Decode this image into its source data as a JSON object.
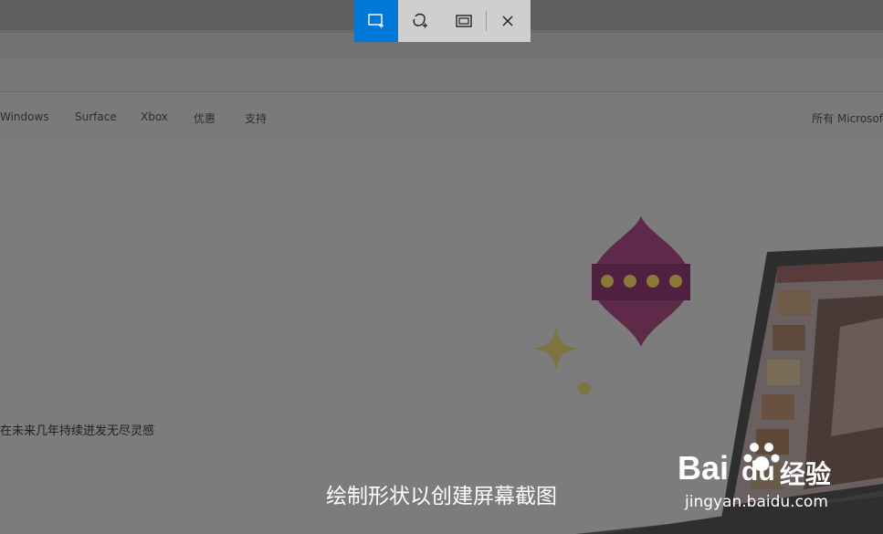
{
  "nav": {
    "items": [
      "Windows",
      "Surface",
      "Xbox",
      "优惠",
      "支持"
    ],
    "right_label": "所有 Microsof"
  },
  "hero": {
    "tagline": "在未来几年持续迸发无尽灵感"
  },
  "snip_toolbar": {
    "modes": [
      "rectangular-snip",
      "freeform-snip",
      "fullscreen-snip"
    ],
    "active_mode": "rectangular-snip",
    "accent_color": "#0078d7"
  },
  "caption": "绘制形状以创建屏幕截图",
  "watermark": {
    "logo_text": "Bai",
    "logo_text2": "du",
    "suffix": "经验",
    "url": "jingyan.baidu.com"
  }
}
